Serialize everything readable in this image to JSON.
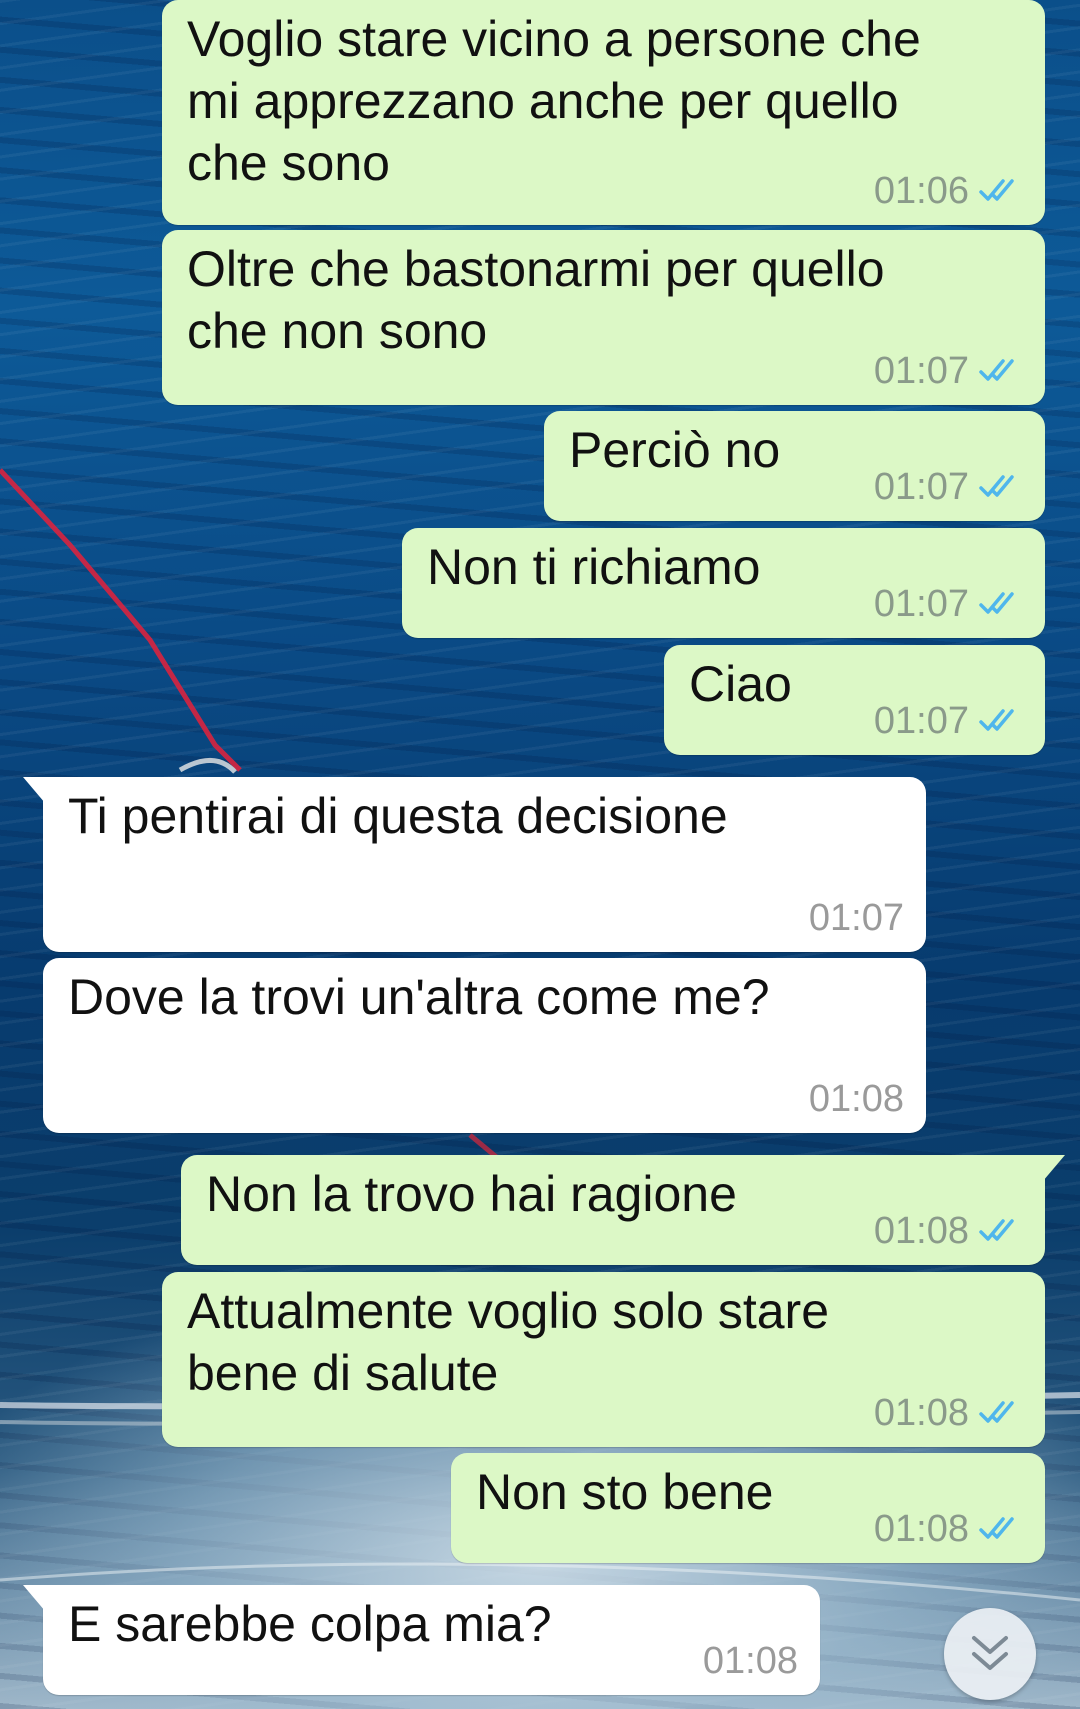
{
  "theme": {
    "outgoing_bubble_color": "#dcf8c6",
    "incoming_bubble_color": "#ffffff",
    "read_tick_color": "#4fb6ec"
  },
  "messages": [
    {
      "direction": "outgoing",
      "text": "Voglio stare vicino a persone che\nmi apprezzano anche per quello\nche sono",
      "time": "01:06",
      "status": "read"
    },
    {
      "direction": "outgoing",
      "text": "Oltre che bastonarmi per quello\nche non sono",
      "time": "01:07",
      "status": "read"
    },
    {
      "direction": "outgoing",
      "text": "Perciò no",
      "time": "01:07",
      "status": "read"
    },
    {
      "direction": "outgoing",
      "text": "Non ti richiamo",
      "time": "01:07",
      "status": "read"
    },
    {
      "direction": "outgoing",
      "text": "Ciao",
      "time": "01:07",
      "status": "read"
    },
    {
      "direction": "incoming",
      "text": "Ti pentirai di questa decisione",
      "time": "01:07"
    },
    {
      "direction": "incoming",
      "text": "Dove la trovi un'altra come me?",
      "time": "01:08"
    },
    {
      "direction": "outgoing",
      "text": "Non la trovo hai ragione",
      "time": "01:08",
      "status": "read"
    },
    {
      "direction": "outgoing",
      "text": "Attualmente voglio solo stare\nbene di salute",
      "time": "01:08",
      "status": "read"
    },
    {
      "direction": "outgoing",
      "text": "Non sto bene",
      "time": "01:08",
      "status": "read"
    },
    {
      "direction": "incoming",
      "text": "E sarebbe colpa mia?",
      "time": "01:08"
    }
  ],
  "scroll_button": {
    "icon": "double-chevron-down-icon"
  }
}
